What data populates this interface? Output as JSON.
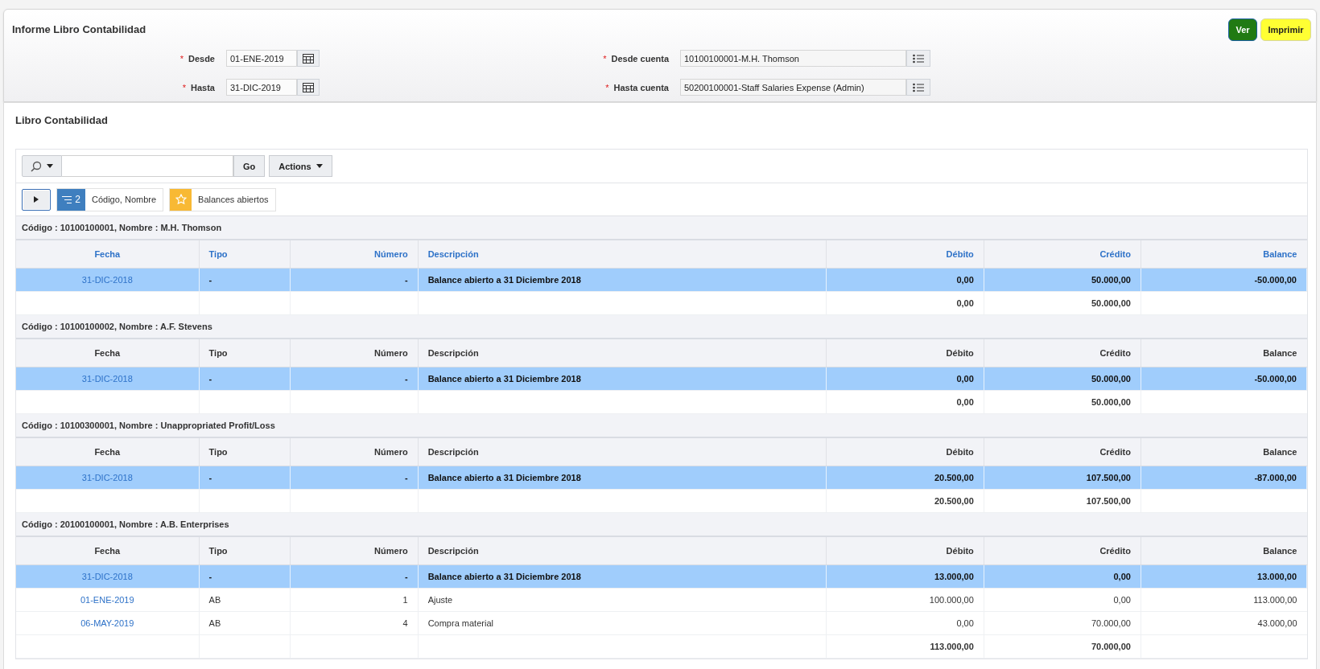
{
  "page_title": "Informe Libro Contabilidad",
  "buttons": [
    {
      "label": "Ver",
      "kind": "primary"
    },
    {
      "label": "Imprimir",
      "kind": "warning"
    }
  ],
  "form_fields": [
    {
      "required_mark": "*",
      "label": "Desde",
      "kind": "date",
      "value": "01-ENE-2019"
    },
    {
      "required_mark": "*",
      "label": "Desde cuenta",
      "kind": "lov",
      "value": "10100100001-M.H. Thomson"
    },
    {
      "required_mark": "*",
      "label": "Hasta",
      "kind": "date",
      "value": "31-DIC-2019"
    },
    {
      "required_mark": "*",
      "label": "Hasta cuenta",
      "kind": "lov",
      "value": "50200100001-Staff Salaries Expense (Admin)"
    }
  ],
  "report": {
    "title": "Libro Contabilidad",
    "toolbar": {
      "go": "Go",
      "actions": "Actions"
    },
    "filters": [
      {
        "kind": "control_break",
        "count": "2",
        "label": "Código, Nombre"
      },
      {
        "kind": "saved_report",
        "label": "Balances abiertos"
      }
    ],
    "groups": [
      {
        "heading": "Código : 10100100001, Nombre : M.H. Thomson",
        "header_highlighted": true,
        "columns": [
          "Fecha",
          "Tipo",
          "Número",
          "Descripción",
          "Débito",
          "Crédito",
          "Balance"
        ],
        "rows": [
          {
            "kind": "opening",
            "cells": [
              "31-DIC-2018",
              "-",
              "-",
              "Balance abierto a 31 Diciembre 2018",
              "0,00",
              "50.000,00",
              "-50.000,00"
            ]
          }
        ],
        "totals": {
          "debit": "0,00",
          "credit": "50.000,00"
        }
      },
      {
        "heading": "Código : 10100100002, Nombre : A.F. Stevens",
        "header_highlighted": false,
        "columns": [
          "Fecha",
          "Tipo",
          "Número",
          "Descripción",
          "Débito",
          "Crédito",
          "Balance"
        ],
        "rows": [
          {
            "kind": "opening",
            "cells": [
              "31-DIC-2018",
              "-",
              "-",
              "Balance abierto a 31 Diciembre 2018",
              "0,00",
              "50.000,00",
              "-50.000,00"
            ]
          }
        ],
        "totals": {
          "debit": "0,00",
          "credit": "50.000,00"
        }
      },
      {
        "heading": "Código : 10100300001, Nombre : Unappropriated Profit/Loss",
        "header_highlighted": false,
        "columns": [
          "Fecha",
          "Tipo",
          "Número",
          "Descripción",
          "Débito",
          "Crédito",
          "Balance"
        ],
        "rows": [
          {
            "kind": "opening",
            "cells": [
              "31-DIC-2018",
              "-",
              "-",
              "Balance abierto a 31 Diciembre 2018",
              "20.500,00",
              "107.500,00",
              "-87.000,00"
            ]
          }
        ],
        "totals": {
          "debit": "20.500,00",
          "credit": "107.500,00"
        }
      },
      {
        "heading": "Código : 20100100001, Nombre : A.B. Enterprises",
        "header_highlighted": false,
        "columns": [
          "Fecha",
          "Tipo",
          "Número",
          "Descripción",
          "Débito",
          "Crédito",
          "Balance"
        ],
        "rows": [
          {
            "kind": "opening",
            "cells": [
              "31-DIC-2018",
              "-",
              "-",
              "Balance abierto a 31 Diciembre 2018",
              "13.000,00",
              "0,00",
              "13.000,00"
            ]
          },
          {
            "kind": "entry",
            "cells": [
              "01-ENE-2019",
              "AB",
              "1",
              "Ajuste",
              "100.000,00",
              "0,00",
              "113.000,00"
            ]
          },
          {
            "kind": "entry",
            "cells": [
              "06-MAY-2019",
              "AB",
              "4",
              "Compra material",
              "0,00",
              "70.000,00",
              "43.000,00"
            ]
          }
        ],
        "totals": {
          "debit": "113.000,00",
          "credit": "70.000,00"
        }
      }
    ]
  }
}
